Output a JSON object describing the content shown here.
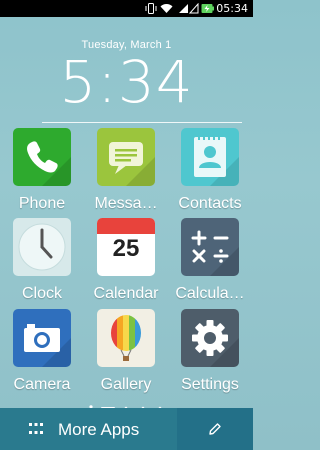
{
  "status_bar": {
    "time": "05:34",
    "icons": [
      "vibrate-icon",
      "wifi-icon",
      "signal-icon",
      "battery-charging-icon"
    ]
  },
  "clock_widget": {
    "date": "Tuesday, March 1",
    "time": "5:34"
  },
  "apps": [
    {
      "id": "phone",
      "label": "Phone",
      "icon": "phone-icon",
      "color": "#2eaa2e"
    },
    {
      "id": "messaging",
      "label": "Messa…",
      "icon": "message-icon",
      "color": "#9bc53d"
    },
    {
      "id": "contacts",
      "label": "Contacts",
      "icon": "contact-icon",
      "color": "#4fc7cf"
    },
    {
      "id": "clock",
      "label": "Clock",
      "icon": "clock-icon",
      "color": "#d7e9ea"
    },
    {
      "id": "calendar",
      "label": "Calendar",
      "icon": "calendar-icon",
      "day": "25",
      "color": "#e8433c"
    },
    {
      "id": "calculator",
      "label": "Calcula…",
      "icon": "calculator-icon",
      "color": "#4e6478"
    },
    {
      "id": "camera",
      "label": "Camera",
      "icon": "camera-icon",
      "color": "#2f6fbd"
    },
    {
      "id": "gallery",
      "label": "Gallery",
      "icon": "balloon-icon",
      "color": "#f2efe4"
    },
    {
      "id": "settings",
      "label": "Settings",
      "icon": "gear-icon",
      "color": "#4e5d6a"
    }
  ],
  "pager": {
    "pages": 4,
    "current": 1
  },
  "dock": {
    "more_apps_label": "More Apps",
    "edit_icon": "pencil-icon"
  }
}
